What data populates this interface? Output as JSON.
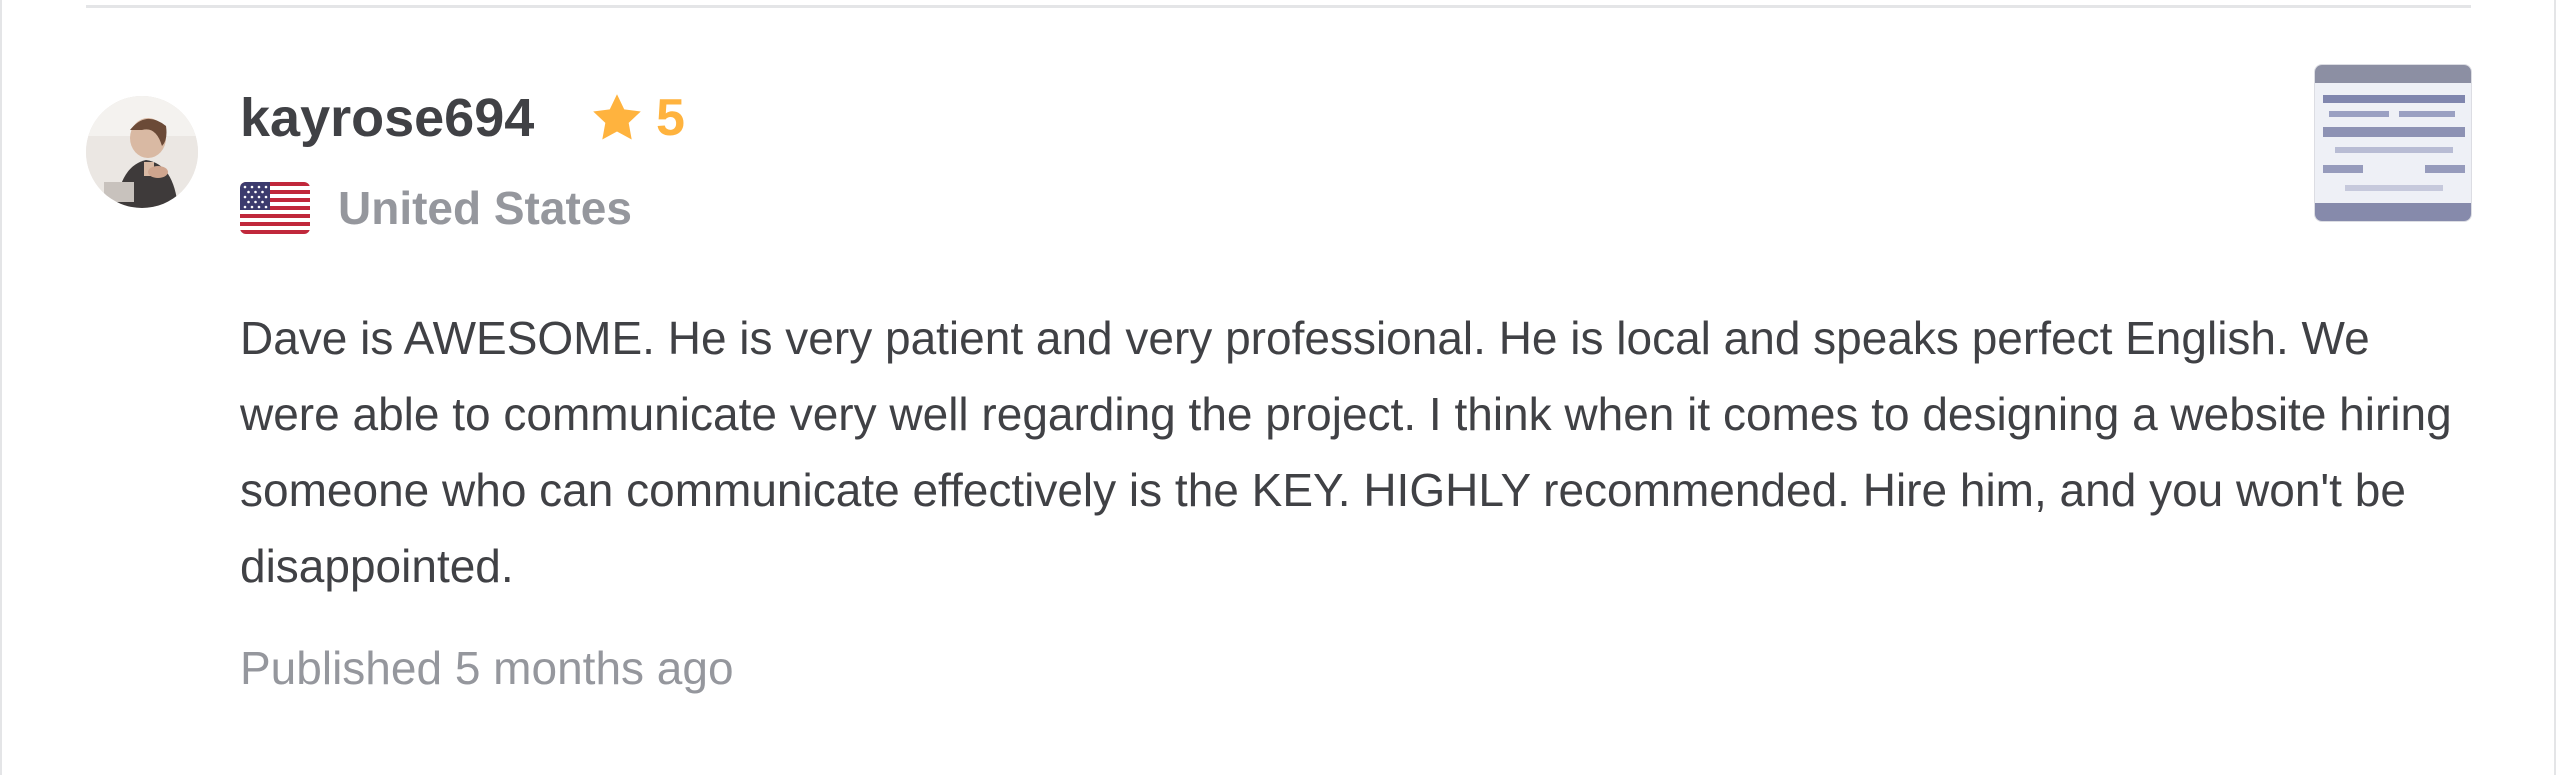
{
  "review": {
    "reviewer_name": "kayrose694",
    "rating": "5",
    "country": "United States",
    "text": "Dave is AWESOME. He is very patient and very professional. He is local and speaks perfect English. We were able to communicate very well regarding the project. I think when it comes to designing a website hiring someone who can communicate effectively is the KEY. HIGHLY recommended. Hire him, and you won't be disappointed.",
    "published": "Published 5 months ago",
    "avatar": "reviewer-avatar",
    "flag_icon": "us-flag-icon",
    "rating_icon": "star-icon",
    "thumbnail": "delivery-preview-thumbnail"
  },
  "colors": {
    "name": "#404145",
    "star": "#ffb33e",
    "muted": "#95979d",
    "divider": "#e4e5e7"
  }
}
